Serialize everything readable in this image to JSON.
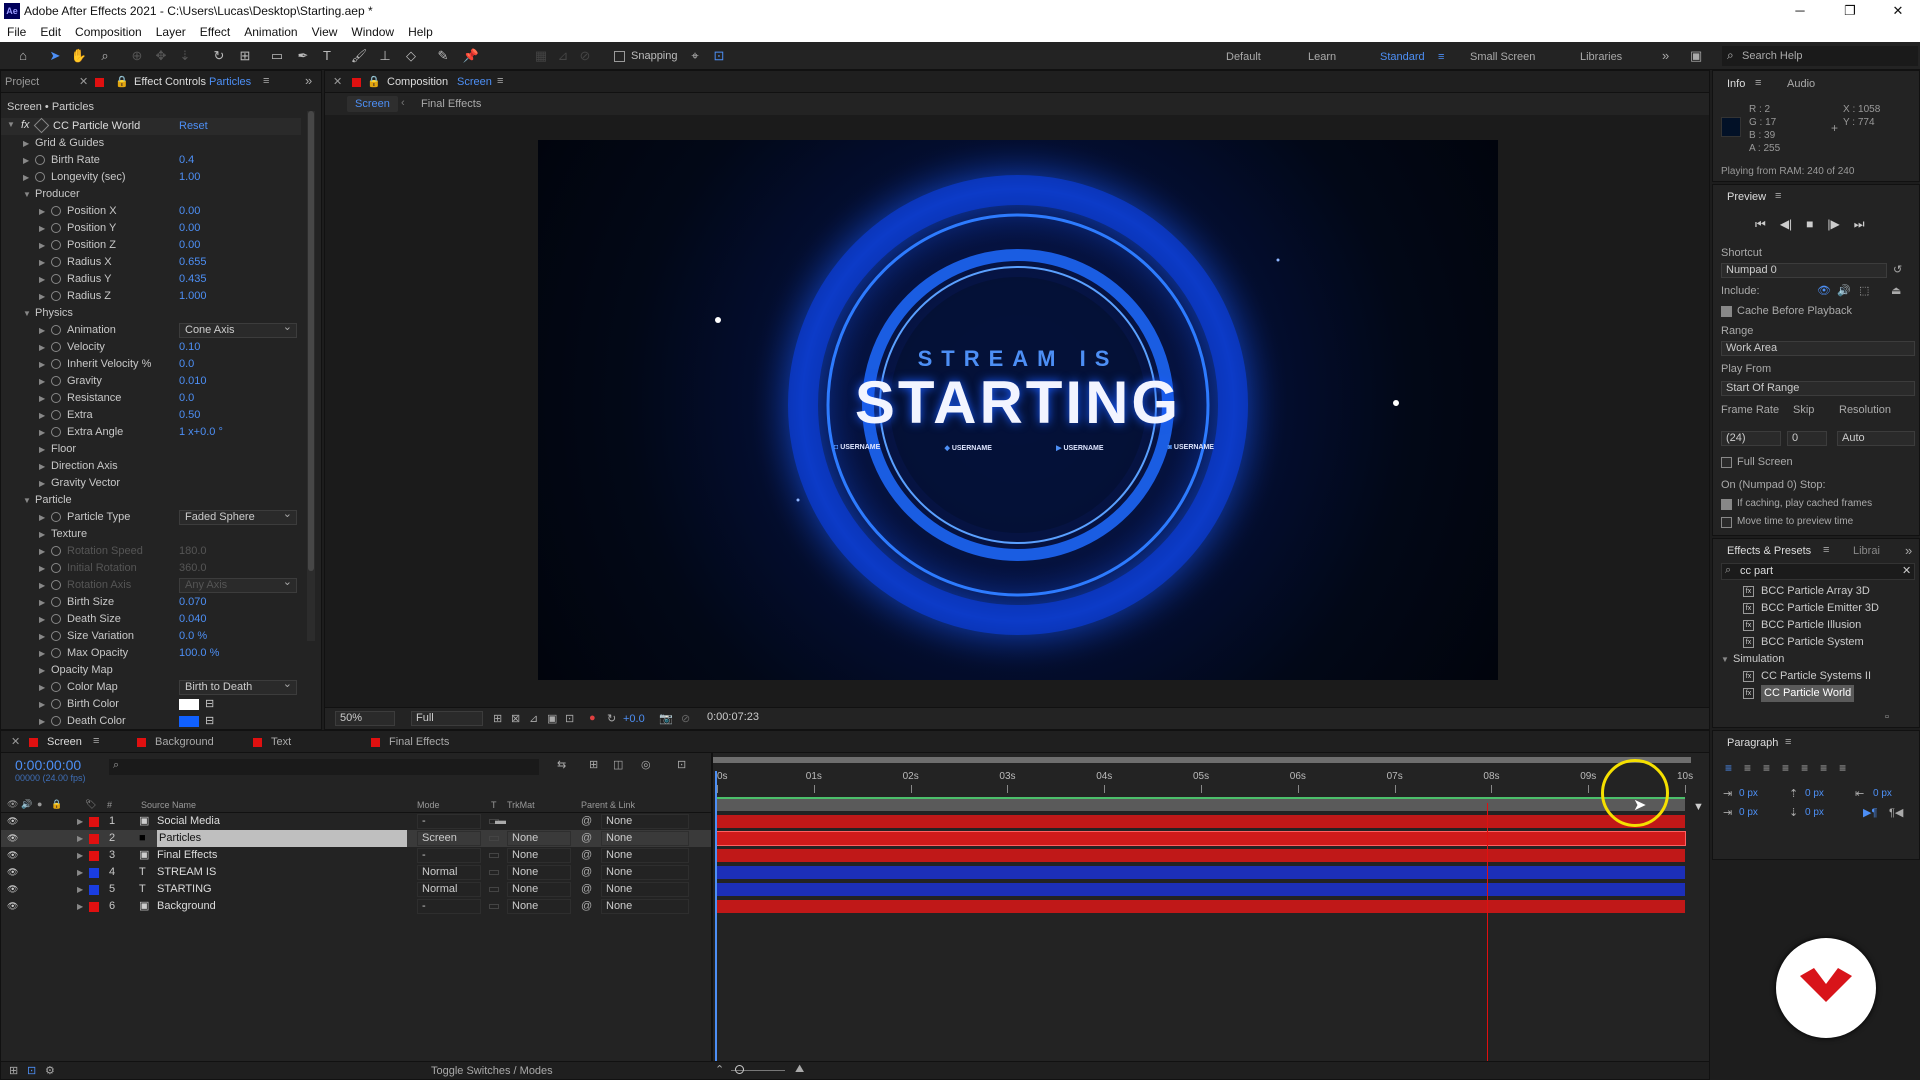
{
  "window": {
    "title": "Adobe After Effects 2021 - C:\\Users\\Lucas\\Desktop\\Starting.aep *",
    "min": "─",
    "max": "❐",
    "close": "✕"
  },
  "menu": [
    "File",
    "Edit",
    "Composition",
    "Layer",
    "Effect",
    "Animation",
    "View",
    "Window",
    "Help"
  ],
  "toolbar": {
    "snapping": "Snapping",
    "workspaces": [
      "Default",
      "Learn",
      "Standard",
      "Small Screen",
      "Libraries"
    ],
    "active_workspace": "Standard",
    "search_help": "Search Help"
  },
  "project_tab": "Project",
  "effect_controls": {
    "tab": "Effect Controls",
    "layer": "Particles",
    "breadcrumb": "Screen • Particles",
    "effect": "CC Particle World",
    "reset": "Reset",
    "rows": [
      {
        "label": "Grid & Guides",
        "value": "",
        "indent": 1
      },
      {
        "label": "Birth Rate",
        "value": "0.4",
        "indent": 1,
        "sw": true
      },
      {
        "label": "Longevity (sec)",
        "value": "1.00",
        "indent": 1,
        "sw": true
      },
      {
        "label": "Producer",
        "value": "",
        "indent": 1,
        "open": true
      },
      {
        "label": "Position X",
        "value": "0.00",
        "indent": 2,
        "sw": true
      },
      {
        "label": "Position Y",
        "value": "0.00",
        "indent": 2,
        "sw": true
      },
      {
        "label": "Position Z",
        "value": "0.00",
        "indent": 2,
        "sw": true
      },
      {
        "label": "Radius X",
        "value": "0.655",
        "indent": 2,
        "sw": true
      },
      {
        "label": "Radius Y",
        "value": "0.435",
        "indent": 2,
        "sw": true
      },
      {
        "label": "Radius Z",
        "value": "1.000",
        "indent": 2,
        "sw": true
      },
      {
        "label": "Physics",
        "value": "",
        "indent": 1,
        "open": true
      },
      {
        "label": "Animation",
        "value": "Cone Axis",
        "indent": 2,
        "sw": true,
        "dd": true
      },
      {
        "label": "Velocity",
        "value": "0.10",
        "indent": 2,
        "sw": true
      },
      {
        "label": "Inherit Velocity %",
        "value": "0.0",
        "indent": 2,
        "sw": true
      },
      {
        "label": "Gravity",
        "value": "0.010",
        "indent": 2,
        "sw": true
      },
      {
        "label": "Resistance",
        "value": "0.0",
        "indent": 2,
        "sw": true
      },
      {
        "label": "Extra",
        "value": "0.50",
        "indent": 2,
        "sw": true
      },
      {
        "label": "Extra Angle",
        "value": "1 x+0.0 °",
        "indent": 2,
        "sw": true
      },
      {
        "label": "Floor",
        "value": "",
        "indent": 2
      },
      {
        "label": "Direction Axis",
        "value": "",
        "indent": 2
      },
      {
        "label": "Gravity Vector",
        "value": "",
        "indent": 2
      },
      {
        "label": "Particle",
        "value": "",
        "indent": 1,
        "open": true
      },
      {
        "label": "Particle Type",
        "value": "Faded Sphere",
        "indent": 2,
        "sw": true,
        "dd": true
      },
      {
        "label": "Texture",
        "value": "",
        "indent": 2
      },
      {
        "label": "Rotation Speed",
        "value": "180.0",
        "indent": 2,
        "sw": true,
        "dis": true
      },
      {
        "label": "Initial Rotation",
        "value": "360.0",
        "indent": 2,
        "sw": true,
        "dis": true
      },
      {
        "label": "Rotation Axis",
        "value": "Any Axis",
        "indent": 2,
        "sw": true,
        "dis": true,
        "dd": true
      },
      {
        "label": "Birth Size",
        "value": "0.070",
        "indent": 2,
        "sw": true
      },
      {
        "label": "Death Size",
        "value": "0.040",
        "indent": 2,
        "sw": true
      },
      {
        "label": "Size Variation",
        "value": "0.0 %",
        "indent": 2,
        "sw": true
      },
      {
        "label": "Max Opacity",
        "value": "100.0 %",
        "indent": 2,
        "sw": true
      },
      {
        "label": "Opacity Map",
        "value": "",
        "indent": 2
      },
      {
        "label": "Color Map",
        "value": "Birth to Death",
        "indent": 2,
        "sw": true,
        "dd": true
      },
      {
        "label": "Birth Color",
        "value": "",
        "indent": 2,
        "sw": true,
        "swatch": "#ffffff"
      },
      {
        "label": "Death Color",
        "value": "",
        "indent": 2,
        "sw": true,
        "swatch": "#1060ff"
      }
    ]
  },
  "composition": {
    "tab": "Composition",
    "name": "Screen",
    "subtabs": [
      "Screen",
      "Final Effects"
    ],
    "viewer": {
      "line1": "STREAM IS",
      "line2": "STARTING",
      "socials": [
        "USERNAME",
        "USERNAME",
        "USERNAME",
        "USERNAME"
      ]
    },
    "footer": {
      "zoom": "50%",
      "res": "Full",
      "exposure": "+0.0",
      "timecode": "0:00:07:23"
    }
  },
  "timeline": {
    "tabs": [
      "Screen",
      "Background",
      "Text",
      "Final Effects"
    ],
    "time": "0:00:00:00",
    "fps": "00000 (24.00 fps)",
    "headers": {
      "source": "Source Name",
      "mode": "Mode",
      "t": "T",
      "trkmat": "TrkMat",
      "parent": "Parent & Link"
    },
    "ruler": [
      "0s",
      "01s",
      "02s",
      "03s",
      "04s",
      "05s",
      "06s",
      "07s",
      "08s",
      "09s",
      "10s"
    ],
    "layers": [
      {
        "num": "1",
        "name": "Social Media",
        "mode": "-",
        "trk": "",
        "parent": "None",
        "color": "#e01010",
        "bar": "#c01818",
        "kind": "comp"
      },
      {
        "num": "2",
        "name": "Particles",
        "mode": "Screen",
        "trk": "None",
        "parent": "None",
        "color": "#e01010",
        "bar": "#d01a1a",
        "kind": "solid",
        "sel": true
      },
      {
        "num": "3",
        "name": "Final Effects",
        "mode": "-",
        "trk": "None",
        "parent": "None",
        "color": "#e01010",
        "bar": "#c01818",
        "kind": "comp"
      },
      {
        "num": "4",
        "name": "STREAM IS",
        "mode": "Normal",
        "trk": "None",
        "parent": "None",
        "color": "#1a3de0",
        "bar": "#1c2fb8",
        "kind": "text"
      },
      {
        "num": "5",
        "name": "STARTING",
        "mode": "Normal",
        "trk": "None",
        "parent": "None",
        "color": "#1a3de0",
        "bar": "#1c2fb8",
        "kind": "text"
      },
      {
        "num": "6",
        "name": "Background",
        "mode": "-",
        "trk": "None",
        "parent": "None",
        "color": "#e01010",
        "bar": "#c01818",
        "kind": "comp"
      }
    ],
    "toggle": "Toggle Switches / Modes"
  },
  "info": {
    "tabs": [
      "Info",
      "Audio"
    ],
    "r": "R : 2",
    "g": "G : 17",
    "b": "B : 39",
    "a": "A : 255",
    "x": "X : 1058",
    "y": "Y : 774",
    "ram": "Playing from RAM: 240 of 240"
  },
  "preview": {
    "title": "Preview",
    "shortcut_label": "Shortcut",
    "shortcut": "Numpad 0",
    "include": "Include:",
    "cache": "Cache Before Playback",
    "range_label": "Range",
    "range": "Work Area",
    "playfrom_label": "Play From",
    "playfrom": "Start Of Range",
    "fr_label": "Frame Rate",
    "skip_label": "Skip",
    "res_label": "Resolution",
    "fr": "(24)",
    "skip": "0",
    "res": "Auto",
    "fullscreen": "Full Screen",
    "stop_label": "On (Numpad 0) Stop:",
    "if_caching": "If caching, play cached frames",
    "move_time": "Move time to preview time"
  },
  "effects_presets": {
    "tabs": [
      "Effects & Presets",
      "Librai"
    ],
    "search": "cc part",
    "items": [
      {
        "t": "BCC Particle Array 3D",
        "lvl": 2
      },
      {
        "t": "BCC Particle Emitter 3D",
        "lvl": 2
      },
      {
        "t": "BCC Particle Illusion",
        "lvl": 2
      },
      {
        "t": "BCC Particle System",
        "lvl": 2
      },
      {
        "t": "Simulation",
        "lvl": 1
      },
      {
        "t": "CC Particle Systems II",
        "lvl": 2
      },
      {
        "t": "CC Particle World",
        "lvl": 2,
        "sel": true
      }
    ]
  },
  "paragraph": {
    "title": "Paragraph",
    "px": [
      "0 px",
      "0 px",
      "0 px",
      "0 px",
      "0 px"
    ]
  },
  "colors": {
    "accent": "#4d8ff5",
    "label_red": "#e01010",
    "label_blue": "#1a3de0",
    "cursor_ring": "#f5e000"
  }
}
